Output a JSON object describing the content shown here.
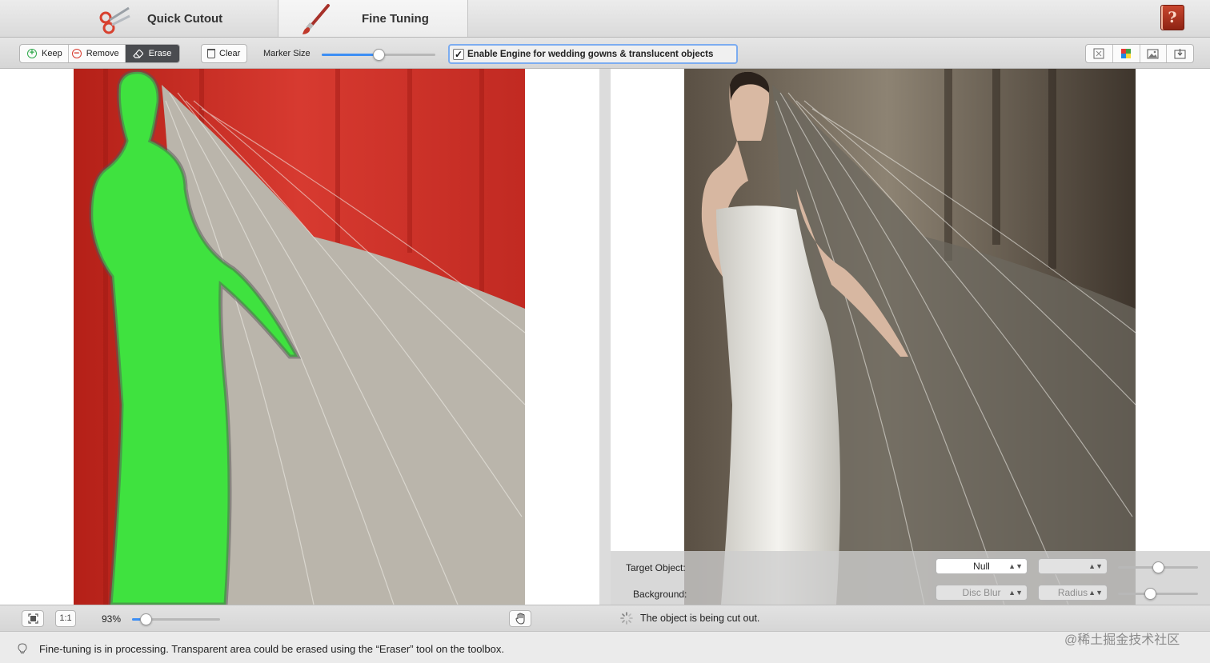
{
  "tabs": [
    {
      "label": "Quick Cutout",
      "icon": "scissors-icon"
    },
    {
      "label": "Fine Tuning",
      "icon": "brush-icon",
      "selected": true
    }
  ],
  "help": {
    "icon": "help-book-icon",
    "glyph": "?"
  },
  "toolbar": {
    "modes": [
      {
        "label": "Keep",
        "icon": "keep-plus-icon",
        "glyph": "+"
      },
      {
        "label": "Remove",
        "icon": "remove-minus-icon",
        "glyph": "−"
      },
      {
        "label": "Erase",
        "icon": "eraser-icon",
        "glyph": "⌫",
        "active": true
      }
    ],
    "clear_label": "Clear",
    "marker_size_label": "Marker Size",
    "marker_size_fraction": 0.5,
    "engine_label": "Enable Engine for wedding gowns & translucent objects",
    "engine_checked": true,
    "engine_check_glyph": "✓",
    "view_icons": [
      "fit-frame-icon",
      "color-palette-icon",
      "image-icon",
      "export-icon"
    ]
  },
  "output_panel": {
    "target_label": "Target Object:",
    "target_value": "Null",
    "target_second_value": "",
    "background_label": "Background:",
    "background_value": "Disc Blur",
    "radius_value": "Radius",
    "target_slider_fraction": 0.5,
    "background_slider_fraction": 0.4
  },
  "zoombar": {
    "fit_icon": "fit-screen-icon",
    "actual_size_label": "1:1",
    "zoom_value": "93%",
    "zoom_fraction": 0.15,
    "hand_icon": "hand-pan-icon",
    "status_text": "The object is being cut out."
  },
  "tip": {
    "icon": "lightbulb-icon",
    "text": "Fine-tuning is in processing. Transparent area could be erased using the “Eraser” tool on the toolbox."
  },
  "credit": "@稀土掘金技术社区",
  "colors": {
    "keep_marker": "#3fe23f",
    "remove_marker": "#c81c1c",
    "accent_blue": "#3d8ef4",
    "erase_active": "#4a4c50"
  }
}
